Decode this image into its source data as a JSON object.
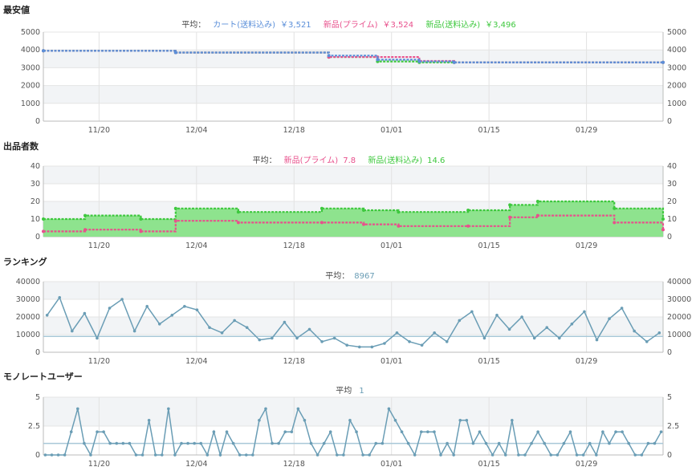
{
  "x_ticks": [
    "11/20",
    "12/04",
    "12/18",
    "01/01",
    "01/15",
    "01/29"
  ],
  "colors": {
    "cart": "#5b8fd9",
    "prime": "#e8508c",
    "new": "#3ec83e",
    "rank": "#6a9db5",
    "avg": "#a8c8d8"
  },
  "chart_data": [
    {
      "type": "line",
      "title": "最安値",
      "legend_prefix": "平均：",
      "legend": [
        {
          "name": "カート(送料込み)",
          "value": "￥3,521",
          "color": "#5b8fd9"
        },
        {
          "name": "新品(プライム)",
          "value": "￥3,524",
          "color": "#e8508c"
        },
        {
          "name": "新品(送料込み)",
          "value": "￥3,496",
          "color": "#3ec83e"
        }
      ],
      "ylim": [
        0,
        5000
      ],
      "yticks": [
        "0",
        "1000",
        "2000",
        "3000",
        "4000",
        "5000"
      ],
      "x_dates": [
        "11/12",
        "12/01",
        "12/23",
        "12/30",
        "01/05",
        "01/10",
        "02/09"
      ],
      "series": [
        {
          "name": "カート(送料込み)",
          "values": [
            3950,
            3850,
            3680,
            3450,
            3350,
            3300,
            3300
          ]
        },
        {
          "name": "新品(プライム)",
          "values": [
            3950,
            3850,
            3600,
            3600,
            3380,
            3300,
            3300
          ]
        },
        {
          "name": "新品(送料込み)",
          "values": [
            3950,
            3850,
            3600,
            3350,
            3300,
            3300,
            3300
          ]
        }
      ]
    },
    {
      "type": "area",
      "title": "出品者数",
      "legend_prefix": "平均：",
      "legend": [
        {
          "name": "新品(プライム)",
          "value": "7.8",
          "color": "#e8508c"
        },
        {
          "name": "新品(送料込み)",
          "value": "14.6",
          "color": "#3ec83e"
        }
      ],
      "ylim": [
        0,
        40
      ],
      "yticks": [
        "0",
        "10",
        "20",
        "30",
        "40"
      ],
      "x_dates": [
        "11/12",
        "11/18",
        "11/26",
        "12/01",
        "12/10",
        "12/22",
        "12/28",
        "01/02",
        "01/12",
        "01/18",
        "01/22",
        "02/02",
        "02/09"
      ],
      "series": [
        {
          "name": "新品(プライム)",
          "values": [
            3,
            4,
            3,
            9,
            8,
            8,
            7,
            6,
            6,
            11,
            12,
            8,
            4
          ]
        },
        {
          "name": "新品(送料込み)",
          "values": [
            10,
            12,
            10,
            16,
            14,
            16,
            15,
            14,
            15,
            18,
            20,
            16,
            10
          ]
        }
      ]
    },
    {
      "type": "line",
      "title": "ランキング",
      "legend_prefix": "平均：",
      "legend": [
        {
          "name": "",
          "value": "8967",
          "color": "#6a9db5"
        }
      ],
      "ylim": [
        0,
        40000
      ],
      "yticks": [
        "0",
        "10000",
        "20000",
        "30000",
        "40000"
      ],
      "average": 8967,
      "series": [
        {
          "name": "",
          "values": [
            21000,
            31000,
            12000,
            22000,
            8000,
            25000,
            30000,
            12000,
            26000,
            16000,
            21000,
            26000,
            24000,
            14000,
            11000,
            18000,
            14000,
            7000,
            8000,
            17000,
            8000,
            13000,
            6000,
            8000,
            4000,
            3000,
            3000,
            5000,
            11000,
            6000,
            4000,
            11000,
            6000,
            18000,
            23000,
            8000,
            21000,
            13000,
            20000,
            8000,
            14000,
            8000,
            16000,
            23000,
            7000,
            19000,
            25000,
            12000,
            6000,
            11000
          ]
        }
      ]
    },
    {
      "type": "line",
      "title": "モノレートユーザー",
      "legend_prefix": "平均",
      "legend": [
        {
          "name": "",
          "value": "1",
          "color": "#6a9db5"
        }
      ],
      "ylim": [
        0,
        5
      ],
      "yticks": [
        "0",
        "2.5",
        "5"
      ],
      "average": 1,
      "series": [
        {
          "name": "",
          "values": [
            0,
            0,
            0,
            0,
            2,
            4,
            1,
            0,
            2,
            2,
            1,
            1,
            1,
            1,
            0,
            0,
            3,
            0,
            0,
            4,
            0,
            1,
            1,
            1,
            1,
            0,
            2,
            0,
            2,
            1,
            0,
            0,
            0,
            3,
            4,
            1,
            1,
            2,
            2,
            4,
            3,
            1,
            0,
            1,
            2,
            0,
            0,
            3,
            2,
            0,
            0,
            1,
            1,
            4,
            3,
            2,
            1,
            0,
            2,
            2,
            2,
            0,
            1,
            0,
            3,
            3,
            1,
            2,
            1,
            0,
            1,
            0,
            3,
            0,
            0,
            1,
            2,
            1,
            0,
            0,
            1,
            2,
            0,
            0,
            1,
            0,
            2,
            1,
            2,
            2,
            1,
            0,
            0,
            1,
            1,
            2
          ]
        }
      ]
    }
  ]
}
